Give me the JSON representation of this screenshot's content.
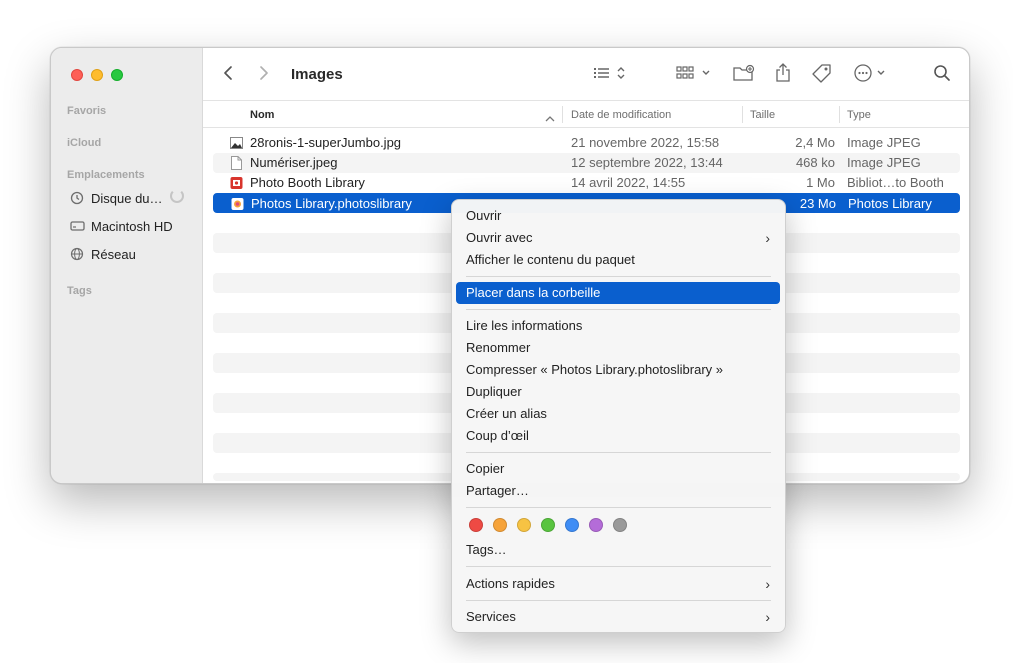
{
  "window": {
    "title": "Images"
  },
  "sidebar": {
    "sections": {
      "favoris": "Favoris",
      "icloud": "iCloud",
      "emplacements": "Emplacements",
      "tags": "Tags"
    },
    "items": [
      {
        "label": "Disque du…",
        "icon": "clock-icon"
      },
      {
        "label": "Macintosh HD",
        "icon": "drive-icon"
      },
      {
        "label": "Réseau",
        "icon": "globe-icon"
      }
    ]
  },
  "columns": {
    "name": "Nom",
    "date": "Date de modification",
    "size": "Taille",
    "type": "Type"
  },
  "files": [
    {
      "name": "28ronis-1-superJumbo.jpg",
      "date": "21 novembre 2022, 15:58",
      "size": "2,4 Mo",
      "type": "Image JPEG"
    },
    {
      "name": "Numériser.jpeg",
      "date": "12 septembre 2022, 13:44",
      "size": "468 ko",
      "type": "Image JPEG"
    },
    {
      "name": "Photo Booth Library",
      "date": "14 avril 2022, 14:55",
      "size": "1 Mo",
      "type": "Bibliot…to Booth"
    },
    {
      "name": "Photos Library.photoslibrary",
      "date": "",
      "size": "23 Mo",
      "type": "Photos Library"
    }
  ],
  "menu": {
    "open": "Ouvrir",
    "open_with": "Ouvrir avec",
    "show_contents": "Afficher le contenu du paquet",
    "trash": "Placer dans la corbeille",
    "get_info": "Lire les informations",
    "rename": "Renommer",
    "compress": "Compresser « Photos Library.photoslibrary »",
    "duplicate": "Dupliquer",
    "alias": "Créer un alias",
    "quicklook": "Coup d’œil",
    "copy": "Copier",
    "share": "Partager…",
    "tags": "Tags…",
    "quick_actions": "Actions rapides",
    "services": "Services",
    "tag_colors": [
      "#ee4a44",
      "#f6a33a",
      "#f7c343",
      "#59c440",
      "#3f8df5",
      "#b46cd8",
      "#9a9a9a"
    ]
  },
  "colors": {
    "accent": "#0a5fce"
  }
}
